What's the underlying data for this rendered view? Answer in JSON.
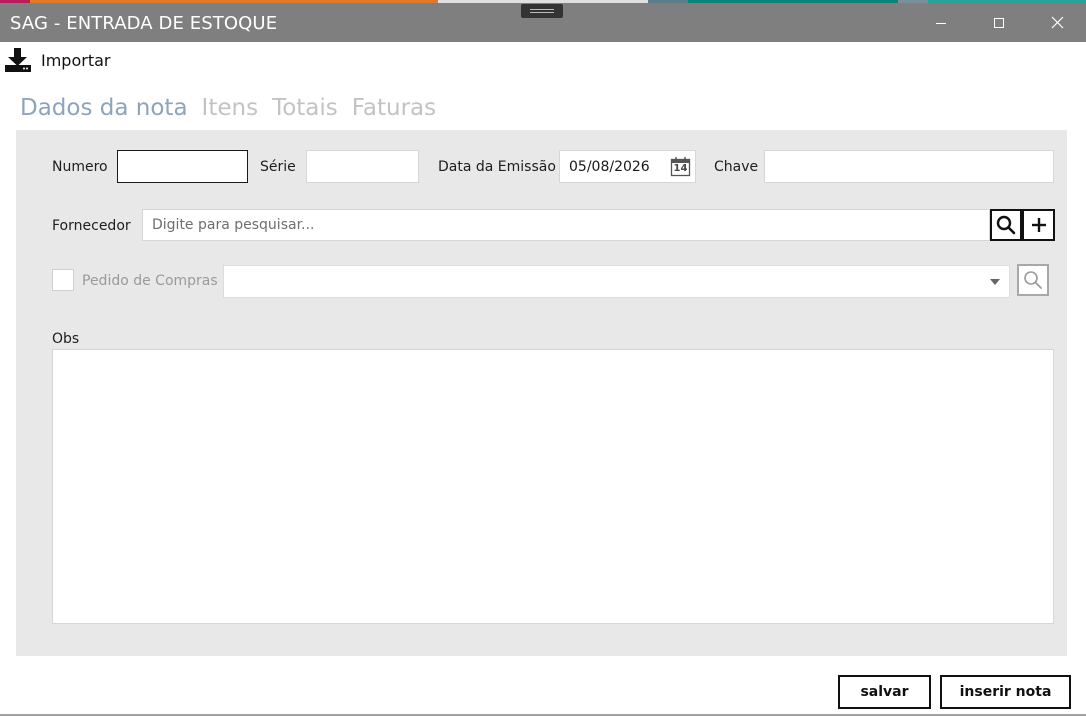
{
  "window": {
    "title": "SAG - ENTRADA DE ESTOQUE",
    "accent_colors": [
      "#c2185b",
      "#e87722",
      "#e0e0e0",
      "#5b7c8d",
      "#00897b",
      "#78909c",
      "#26a69a"
    ]
  },
  "toolbar": {
    "import_label": "Importar",
    "import_icon": "download-icon"
  },
  "tabs": [
    {
      "label": "Dados da nota",
      "active": true
    },
    {
      "label": "Itens",
      "active": false
    },
    {
      "label": "Totais",
      "active": false
    },
    {
      "label": "Faturas",
      "active": false
    }
  ],
  "form": {
    "numero": {
      "label": "Numero",
      "value": ""
    },
    "serie": {
      "label": "Série",
      "value": ""
    },
    "data_emissao": {
      "label": "Data da Emissão",
      "value": "05/08/2026",
      "calendar_day": "14"
    },
    "chave": {
      "label": "Chave",
      "value": ""
    },
    "fornecedor": {
      "label": "Fornecedor",
      "placeholder": "Digite para pesquisar...",
      "value": ""
    },
    "pedido_compras": {
      "label": "Pedido de Compras",
      "checked": false,
      "value": ""
    },
    "obs": {
      "label": "Obs",
      "value": ""
    }
  },
  "actions": {
    "salvar_label": "salvar",
    "inserir_label": "inserir nota"
  },
  "colors": {
    "titlebar": "#7f7f7f",
    "tab_active": "#8ea4b9",
    "tab_inactive": "#c3c3c3",
    "panel": "#e8e8e8"
  }
}
